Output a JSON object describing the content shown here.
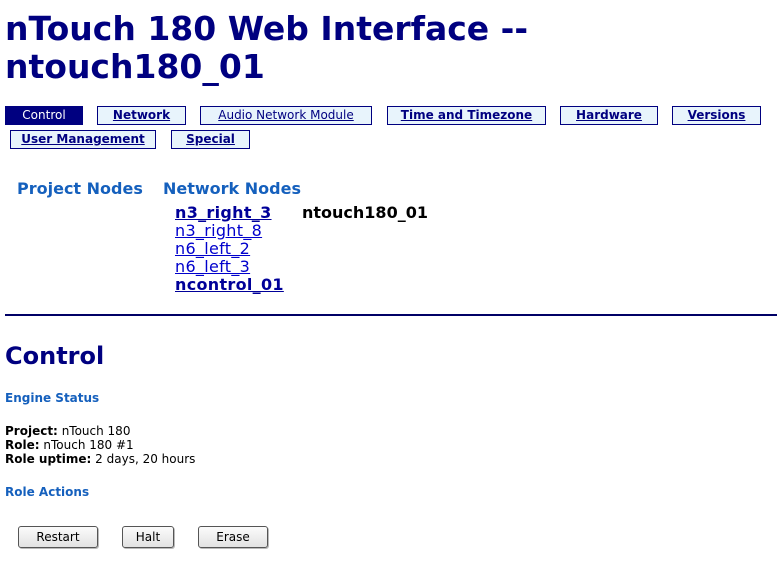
{
  "page": {
    "title": "nTouch 180 Web Interface -- ntouch180_01"
  },
  "tabs": [
    {
      "label": "Control",
      "active": true
    },
    {
      "label": "Network",
      "active": false
    },
    {
      "label": "Audio Network Module",
      "active": false
    },
    {
      "label": "Time and Timezone",
      "active": false
    },
    {
      "label": "Hardware",
      "active": false
    },
    {
      "label": "Versions",
      "active": false
    },
    {
      "label": "User Management",
      "active": false
    },
    {
      "label": "Special",
      "active": false
    }
  ],
  "nodes": {
    "project_heading": "Project Nodes",
    "network_heading": "Network Nodes",
    "list": [
      {
        "name": "n3_right_3",
        "bold": true
      },
      {
        "name": "n3_right_8",
        "bold": false
      },
      {
        "name": "n6_left_2",
        "bold": false
      },
      {
        "name": "n6_left_3",
        "bold": false
      },
      {
        "name": "ncontrol_01",
        "bold": true
      }
    ],
    "current_label": "ntouch180_01"
  },
  "control": {
    "title": "Control",
    "engine_status_heading": "Engine Status",
    "project_label": "Project:",
    "project_value": "nTouch 180",
    "role_label": "Role:",
    "role_value": "nTouch 180 #1",
    "uptime_label": "Role uptime:",
    "uptime_value": "2 days, 20 hours",
    "role_actions_heading": "Role Actions",
    "buttons": {
      "restart": "Restart",
      "halt": "Halt",
      "erase": "Erase"
    }
  },
  "colors": {
    "navy": "#000080",
    "heading_blue": "#1560bd",
    "tab_bg": "#e8f4fc",
    "link": "#0000cc"
  }
}
